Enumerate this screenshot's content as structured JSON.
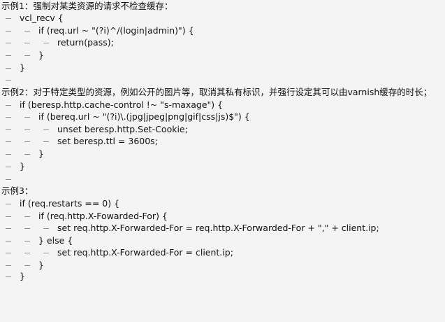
{
  "examples": [
    {
      "heading": "示例1：强制对某类资源的请求不检查缓存：",
      "lines": [
        "vcl_recv {",
        "if (req.url ~ \"(?i)^/(login|admin)\") {",
        "return(pass);",
        "}",
        "}"
      ]
    },
    {
      "heading": "示例2：对于特定类型的资源，例如公开的图片等，取消其私有标识，并强行设定其可以由varnish缓存的时长；",
      "lines": [
        "if (beresp.http.cache-control !~ \"s-maxage\") {",
        "if (bereq.url ~ \"(?i)\\.(jpg|jpeg|png|gif|css|js)$\") {",
        "unset beresp.http.Set-Cookie;",
        "set beresp.ttl = 3600s;",
        "}",
        "}"
      ]
    },
    {
      "heading": "示例3：",
      "lines": [
        "if (req.restarts == 0) {",
        "if (req.http.X-Fowarded-For) {",
        "set req.http.X-Forwarded-For = req.http.X-Forwarded-For + \",\" + client.ip;",
        "} else {",
        "set req.http.X-Forwarded-For = client.ip;",
        "}",
        "}"
      ]
    }
  ]
}
